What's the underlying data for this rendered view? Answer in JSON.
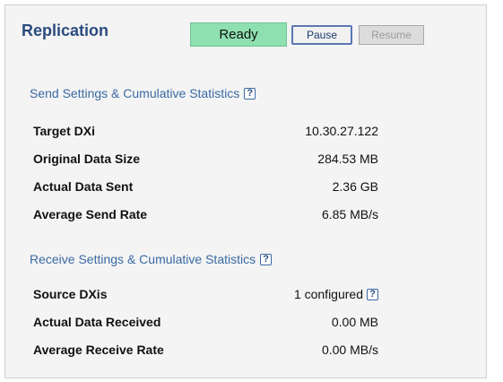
{
  "header": {
    "title": "Replication",
    "status": "Ready",
    "pause_label": "Pause",
    "resume_label": "Resume",
    "status_color": "#8fe0b0"
  },
  "send": {
    "title": "Send Settings & Cumulative Statistics",
    "help_icon": "?",
    "rows": [
      {
        "label": "Target DXi",
        "value": "10.30.27.122"
      },
      {
        "label": "Original Data Size",
        "value": "284.53 MB"
      },
      {
        "label": "Actual Data Sent",
        "value": "2.36 GB"
      },
      {
        "label": "Average Send Rate",
        "value": "6.85 MB/s"
      }
    ]
  },
  "receive": {
    "title": "Receive Settings & Cumulative Statistics",
    "help_icon": "?",
    "rows": [
      {
        "label": "Source DXis",
        "value": "1 configured",
        "help_icon": "?"
      },
      {
        "label": "Actual Data Received",
        "value": "0.00 MB"
      },
      {
        "label": "Average Receive Rate",
        "value": "0.00 MB/s"
      }
    ]
  },
  "colors": {
    "title": "#2b4b7e",
    "section_title": "#3a6aa3",
    "panel_bg": "#f4f4f4"
  }
}
